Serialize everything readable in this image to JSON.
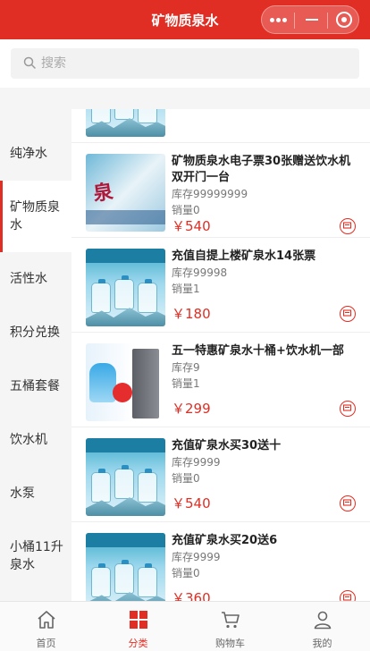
{
  "header": {
    "title": "矿物质泉水"
  },
  "search": {
    "placeholder": "搜索"
  },
  "categories": [
    {
      "label": "纯净水",
      "active": false
    },
    {
      "label": "矿物质泉水",
      "active": true
    },
    {
      "label": "活性水",
      "active": false
    },
    {
      "label": "积分兑换",
      "active": false
    },
    {
      "label": "五桶套餐",
      "active": false
    },
    {
      "label": "饮水机",
      "active": false
    },
    {
      "label": "水泵",
      "active": false
    },
    {
      "label": "小桶11升泉水",
      "active": false
    }
  ],
  "products": [
    {
      "name": "",
      "stock": "",
      "sales": "",
      "price": "",
      "image": "water-bottles-image"
    },
    {
      "name": "矿物质泉水电子票30张赠送饮水机双开门一台",
      "stock": "库存99999999",
      "sales": "销量0",
      "price": "￥540",
      "image": "mineral-water-ticket-image"
    },
    {
      "name": "充值自提上楼矿泉水14张票",
      "stock": "库存99998",
      "sales": "销量1",
      "price": "￥180",
      "image": "water-bottles-image"
    },
    {
      "name": "五一特惠矿泉水十桶+饮水机一部",
      "stock": "库存9",
      "sales": "销量1",
      "price": "￥299",
      "image": "water-dispenser-image"
    },
    {
      "name": "充值矿泉水买30送十",
      "stock": "库存9999",
      "sales": "销量0",
      "price": "￥540",
      "image": "water-bottles-image"
    },
    {
      "name": "充值矿泉水买20送6",
      "stock": "库存9999",
      "sales": "销量0",
      "price": "￥360",
      "image": "water-bottles-image"
    }
  ],
  "tabs": [
    {
      "label": "首页",
      "icon": "home-icon",
      "active": false
    },
    {
      "label": "分类",
      "icon": "category-icon",
      "active": true
    },
    {
      "label": "购物车",
      "icon": "cart-icon",
      "active": false
    },
    {
      "label": "我的",
      "icon": "user-icon",
      "active": false
    }
  ],
  "colors": {
    "accent": "#e02e24",
    "background": "#f5f5f5"
  }
}
